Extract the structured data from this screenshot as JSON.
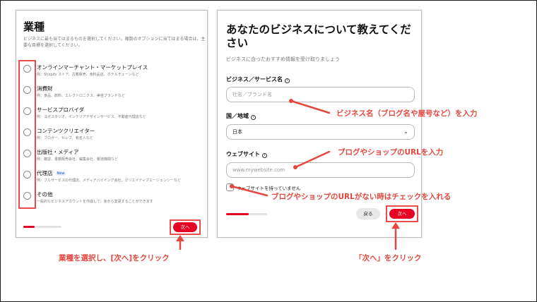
{
  "left_panel": {
    "title": "業種",
    "description": "ビジネスに最も当てはまるものを選択してください。複数のオプションに当てはまる場合は、主要な目標を選択してください。",
    "options": [
      {
        "label": "オンラインマーチャント・マーケットプレイス",
        "sub": "例：Shopify ストア、古着販売、食料品店、ホテルチェーンなど",
        "badge": ""
      },
      {
        "label": "消費財",
        "sub": "例：食品、飲料、エレクトロニクス、美容ブランドなど",
        "badge": ""
      },
      {
        "label": "サービスプロバイダ",
        "sub": "例：ヨガスタジオ、インテリアデザインサービス、不動産代理店など",
        "badge": ""
      },
      {
        "label": "コンテンツクリエイター",
        "sub": "例：ブロガー、セレブ、有名人など",
        "badge": ""
      },
      {
        "label": "出版社・メディア",
        "sub": "例：雑誌、書籍販売会社、編集会社、報道機関など",
        "badge": ""
      },
      {
        "label": "代理店",
        "sub": "例：フルサービスの代理店、メディアバイイング会社、クリエイティブエージェンシーなど",
        "badge": "New"
      },
      {
        "label": "その他",
        "sub": "一般的なビジネスアカウントを作成して、後から変更することができます",
        "badge": ""
      }
    ],
    "next_label": "次へ",
    "progress": 0.3
  },
  "right_panel": {
    "title": "あなたのビジネスについて教えてください",
    "description": "ビジネスに合ったおすすめ情報を受け取りましょう",
    "business_name": {
      "label": "ビジネス／サービス名",
      "placeholder": "社名／ブランド名"
    },
    "country": {
      "label": "国／地域",
      "value": "日本"
    },
    "website": {
      "label": "ウェブサイト",
      "placeholder": "www.mywebsite.com"
    },
    "no_website_label": "ウェブサイトを持っていません",
    "back_label": "戻る",
    "next_label": "次へ",
    "progress": 0.55
  },
  "annotations": {
    "business_name": "ビジネス名（ブログ名や屋号など）を入力",
    "website": "ブログやショップのURLを入力",
    "no_website": "ブログやショップのURLがない時はチェックを入れる",
    "left_caption": "業種を選択し、[次へ]をクリック",
    "right_caption": "「次へ」をクリック"
  },
  "icons": {
    "info": "info-icon",
    "dropdown": "chevron-down-icon"
  },
  "colors": {
    "accent": "#e60023",
    "annotation": "#e5473f"
  }
}
